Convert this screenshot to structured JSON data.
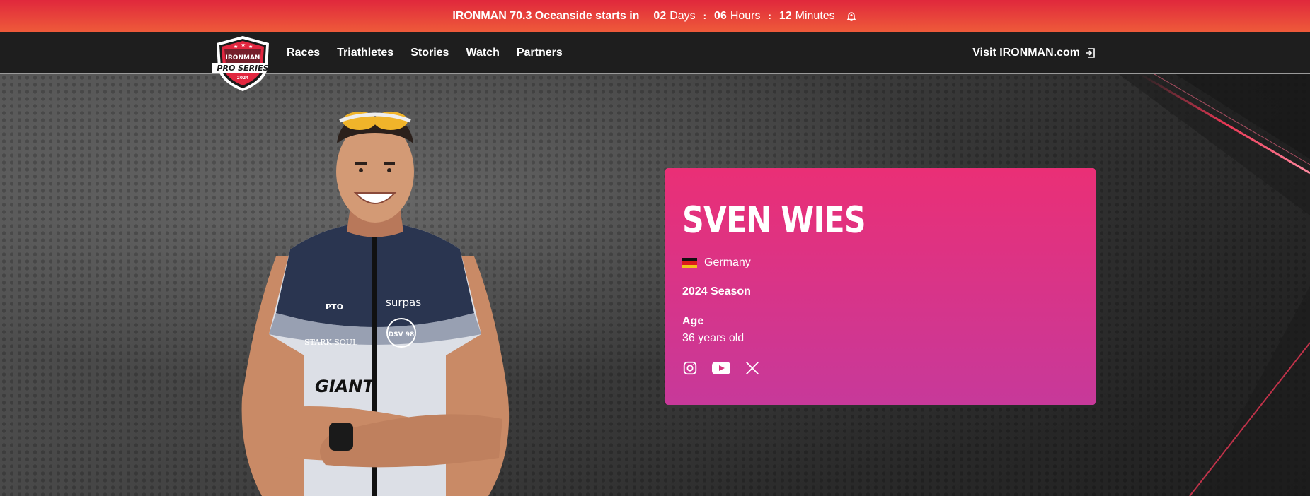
{
  "banner": {
    "lead": "IRONMAN 70.3 Oceanside starts in",
    "days_num": "02",
    "days_label": "Days",
    "hours_num": "06",
    "hours_label": "Hours",
    "minutes_num": "12",
    "minutes_label": "Minutes",
    "separator": ":",
    "bell_icon": "bell-icon"
  },
  "nav": {
    "logo": {
      "text_top": "IRONMAN",
      "text_main": "PRO SERIES",
      "year": "2024"
    },
    "links": [
      "Races",
      "Triathletes",
      "Stories",
      "Watch",
      "Partners"
    ],
    "visit_label": "Visit IRONMAN.com",
    "visit_icon": "external-link-icon"
  },
  "athlete": {
    "name": "SVEN WIES",
    "country": "Germany",
    "season": "2024 Season",
    "age_label": "Age",
    "age_value": "36 years old",
    "socials": [
      "instagram-icon",
      "youtube-icon",
      "x-twitter-icon"
    ],
    "jersey_text": [
      "PTO",
      "surpas",
      "STARK SOUL",
      "DSV 98",
      "GIANT"
    ]
  },
  "colors": {
    "banner_top": "#e0283c",
    "banner_bottom": "#ee5a3a",
    "nav_bg": "#1e1e1e",
    "card_top": "#ea2f76",
    "card_bottom": "#c7399a",
    "accent_red": "#e2263f"
  }
}
